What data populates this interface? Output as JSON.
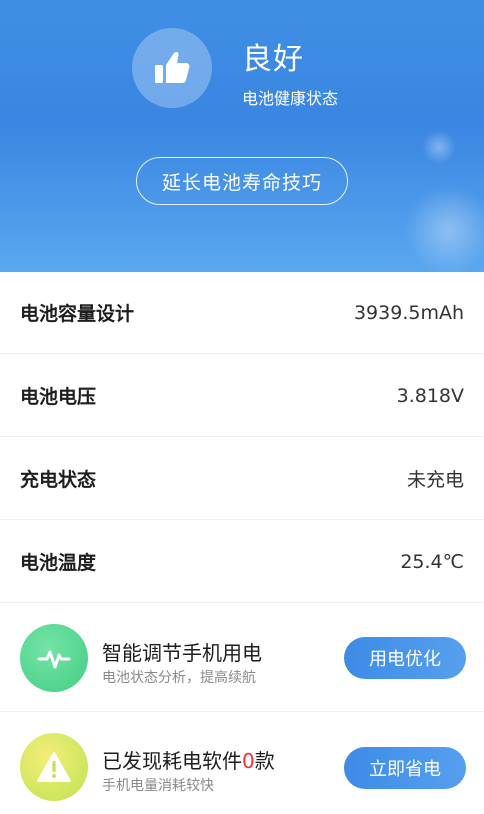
{
  "header": {
    "status_title": "良好",
    "status_subtitle": "电池健康状态",
    "tips_button": "延长电池寿命技巧"
  },
  "info_rows": [
    {
      "label": "电池容量设计",
      "value": "3939.5mAh"
    },
    {
      "label": "电池电压",
      "value": "3.818V"
    },
    {
      "label": "充电状态",
      "value": "未充电"
    },
    {
      "label": "电池温度",
      "value": "25.4℃"
    }
  ],
  "features": [
    {
      "title": "智能调节手机用电",
      "subtitle": "电池状态分析，提高续航",
      "button": "用电优化",
      "icon": "pulse-icon"
    },
    {
      "title_prefix": "已发现耗电软件",
      "count": "0",
      "title_suffix": "款",
      "subtitle": "手机电量消耗较快",
      "button": "立即省电",
      "icon": "warning-icon"
    }
  ],
  "colors": {
    "header_blue": "#3f8fe4",
    "button_blue": "#4a95ea",
    "count_red": "#ff2d2d"
  }
}
